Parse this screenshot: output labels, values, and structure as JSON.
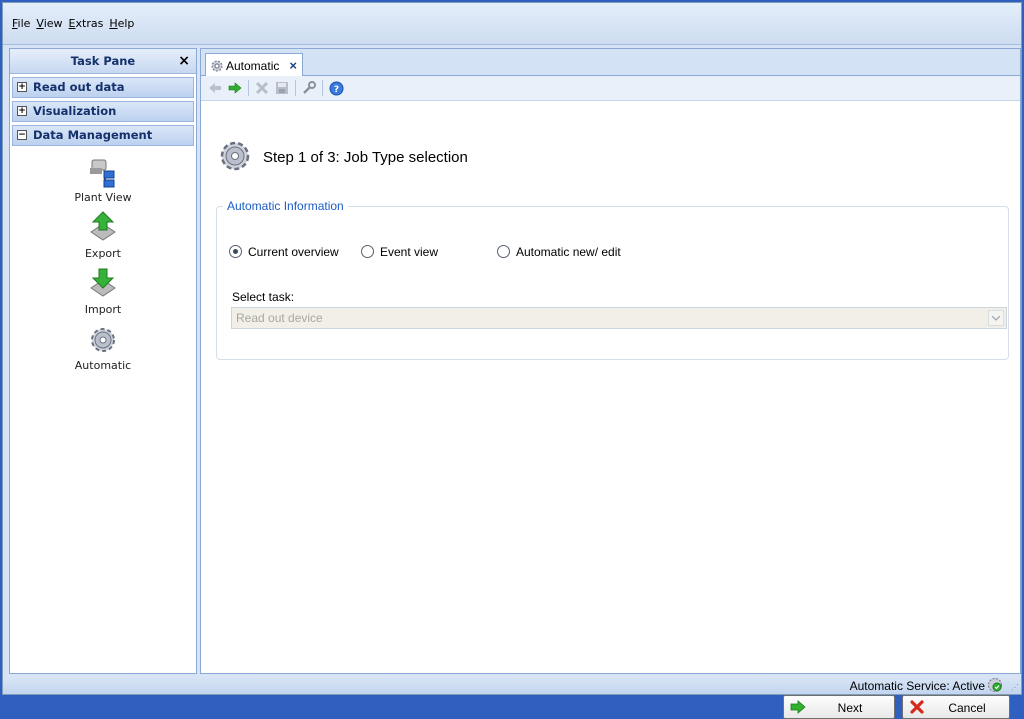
{
  "menu": [
    {
      "underline": "F",
      "rest": "ile"
    },
    {
      "underline": "V",
      "rest": "iew"
    },
    {
      "underline": "E",
      "rest": "xtras"
    },
    {
      "underline": "H",
      "rest": "elp"
    }
  ],
  "taskpane": {
    "title": "Task Pane",
    "close": "×",
    "groups": [
      {
        "label": "Read out data",
        "state": "+"
      },
      {
        "label": "Visualization",
        "state": "+"
      },
      {
        "label": "Data Management",
        "state": "−"
      }
    ],
    "tools": [
      {
        "label": "Plant View",
        "icon": "plant-view-icon"
      },
      {
        "label": "Export",
        "icon": "export-icon"
      },
      {
        "label": "Import",
        "icon": "import-icon"
      },
      {
        "label": "Automatic",
        "icon": "gear-icon"
      }
    ]
  },
  "tab": {
    "label": "Automatic",
    "close": "×"
  },
  "toolbar": {
    "buttons": [
      "back-arrow-icon",
      "forward-arrow-icon",
      "delete-icon",
      "save-icon",
      "wrench-icon",
      "help-icon"
    ]
  },
  "wizard": {
    "step_title": "Step 1 of 3: Job Type selection",
    "group_legend": "Automatic Information",
    "radios": [
      {
        "label": "Current overview",
        "checked": true
      },
      {
        "label": "Event view",
        "checked": false
      },
      {
        "label": "Automatic new/ edit",
        "checked": false
      }
    ],
    "select_label": "Select task:",
    "select_value": "Read out device"
  },
  "buttons": {
    "next": "Next",
    "cancel": "Cancel"
  },
  "status": {
    "text": "Automatic Service: Active"
  },
  "colors": {
    "accent": "#1d5cc4",
    "header_text": "#15316b",
    "window_bg": "#d6e4f5"
  }
}
